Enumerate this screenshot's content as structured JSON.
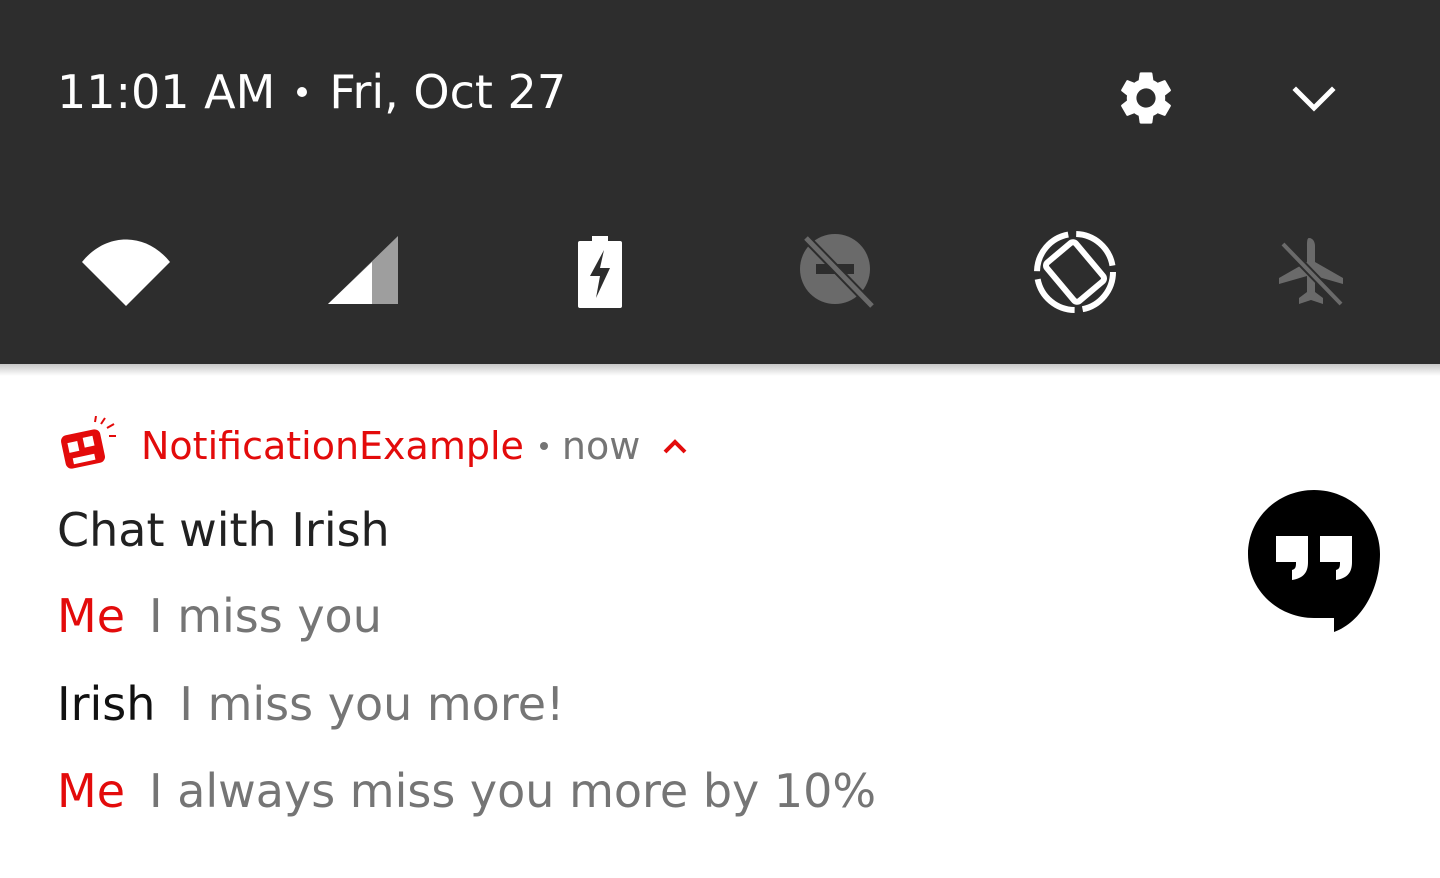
{
  "status_header": {
    "time": "11:01 AM",
    "date": "Fri, Oct 27",
    "settings_icon": "gear-icon",
    "collapse_icon": "chevron-down-icon"
  },
  "quick_settings": [
    {
      "name": "wifi",
      "icon": "wifi-icon",
      "state": "on"
    },
    {
      "name": "cellular",
      "icon": "cellular-signal-icon",
      "state": "on"
    },
    {
      "name": "battery",
      "icon": "battery-charging-icon",
      "state": "charging"
    },
    {
      "name": "do-not-disturb",
      "icon": "do-not-disturb-off-icon",
      "state": "off"
    },
    {
      "name": "auto-rotate",
      "icon": "auto-rotate-icon",
      "state": "on"
    },
    {
      "name": "airplane-mode",
      "icon": "airplane-mode-off-icon",
      "state": "off"
    }
  ],
  "notification": {
    "app_name": "NotificationExample",
    "time": "now",
    "title": "Chat with Irish",
    "messages": [
      {
        "sender": "Me",
        "text": "I miss you"
      },
      {
        "sender": "Irish",
        "text": "I miss you more!"
      },
      {
        "sender": "Me",
        "text": "I always miss you more by 10%"
      }
    ],
    "large_icon": "hangouts-quote-icon"
  },
  "colors": {
    "shade_background": "#2d2d2d",
    "accent": "#e30b0b",
    "secondary_text": "#757575",
    "primary_text": "#212121"
  }
}
